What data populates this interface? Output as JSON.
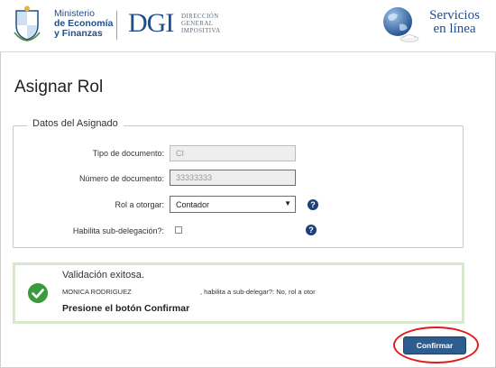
{
  "header": {
    "ministry_line1": "Ministerio",
    "ministry_line2": "de Economía",
    "ministry_line3": "y Finanzas",
    "dgi_logo": "DGI",
    "dgi_sub1": "DIRECCIÓN",
    "dgi_sub2": "GENERAL",
    "dgi_sub3": "IMPOSITIVA",
    "services_line1": "Servicios",
    "services_line2": "en línea",
    "icons": [
      "shield-icon",
      "globe-icon"
    ]
  },
  "page": {
    "title": "Asignar Rol"
  },
  "form": {
    "legend": "Datos del Asignado",
    "doc_type_label": "Tipo de documento:",
    "doc_type_value": "CI",
    "doc_number_label": "Número de documento:",
    "doc_number_value": "33333333",
    "role_label": "Rol a otorgar:",
    "role_value": "Contador",
    "subdelegation_label": "Habilita sub-delegación?:",
    "subdelegation_checked": false,
    "help_glyph": "?"
  },
  "validation": {
    "title": "Validación exitosa.",
    "name": "MONICA RODRIGUEZ",
    "detail": ", habilita a sub-delegar?: No, rol a otor",
    "instruction": "Presione el botón Confirmar"
  },
  "actions": {
    "confirm_label": "Confirmar"
  },
  "colors": {
    "brand_blue": "#1f4e8c",
    "button_blue": "#2d5c8f",
    "success_green": "#3a9a3d",
    "success_border": "#d8e8cf",
    "highlight_red": "#e11b1b"
  }
}
